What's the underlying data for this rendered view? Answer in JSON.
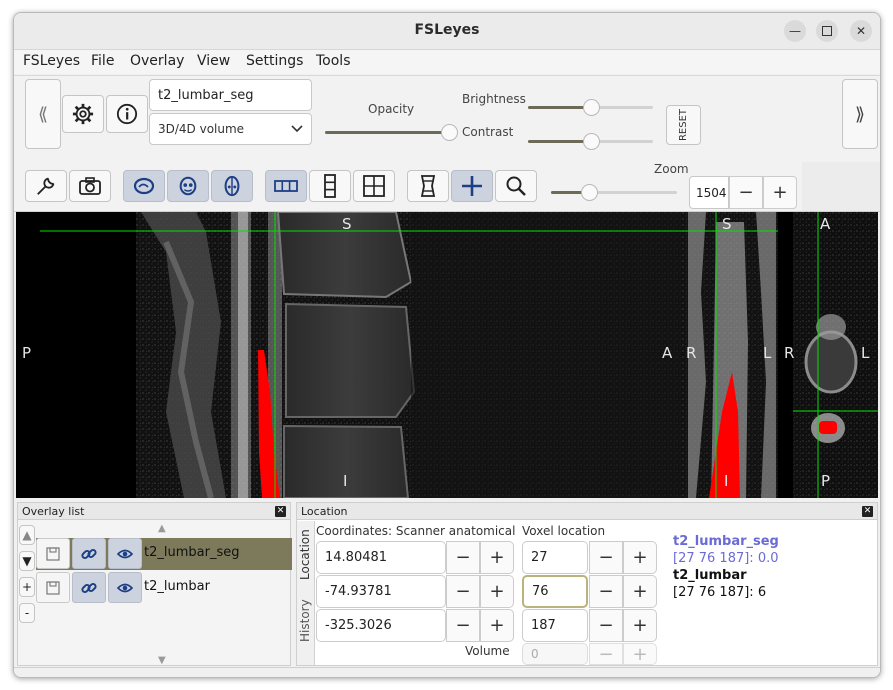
{
  "window": {
    "title": "FSLeyes"
  },
  "menubar": {
    "items": [
      "FSLeyes",
      "File",
      "Overlay",
      "View",
      "Settings",
      "Tools"
    ]
  },
  "overlay_toolbar": {
    "overlay_name": "t2_lumbar_seg",
    "overlay_type": "3D/4D volume",
    "opacity_label": "Opacity",
    "brightness_label": "Brightness",
    "contrast_label": "Contrast",
    "reset_label": "RESET",
    "opacity": 0.95,
    "brightness": 0.5,
    "contrast": 0.5
  },
  "ortho_toolbar": {
    "zoom_label": "Zoom",
    "zoom_value": "1504",
    "zoom_slider": 0.3
  },
  "viewer": {
    "sagittal": {
      "top": "S",
      "left": "P",
      "right": "A",
      "bottom": "I"
    },
    "coronal": {
      "top": "S",
      "left": "R",
      "right": "L",
      "bottom": "I"
    },
    "axial": {
      "top": "A",
      "left": "R",
      "right": "L",
      "bottom": "P"
    },
    "segmentation_color": "#ff0000",
    "cursor_color": "#00ff00"
  },
  "overlay_list": {
    "title": "Overlay list",
    "items": [
      {
        "name": "t2_lumbar_seg",
        "selected": true
      },
      {
        "name": "t2_lumbar",
        "selected": false
      }
    ],
    "side_buttons": [
      "▲",
      "▼",
      "+",
      "-"
    ]
  },
  "location": {
    "title": "Location",
    "tabs": [
      "Location",
      "History"
    ],
    "coordinates_label": "Coordinates: Scanner anatomical",
    "voxel_label": "Voxel location",
    "volume_label": "Volume",
    "coordinates": [
      "14.80481",
      "-74.93781",
      "-325.3026"
    ],
    "voxels": [
      "27",
      "76",
      "187"
    ],
    "volume": "0",
    "info": {
      "seg_name": "t2_lumbar_seg",
      "seg_value": "[27 76 187]: 0.0",
      "img_name": "t2_lumbar",
      "img_value": "[27 76 187]: 6"
    }
  }
}
